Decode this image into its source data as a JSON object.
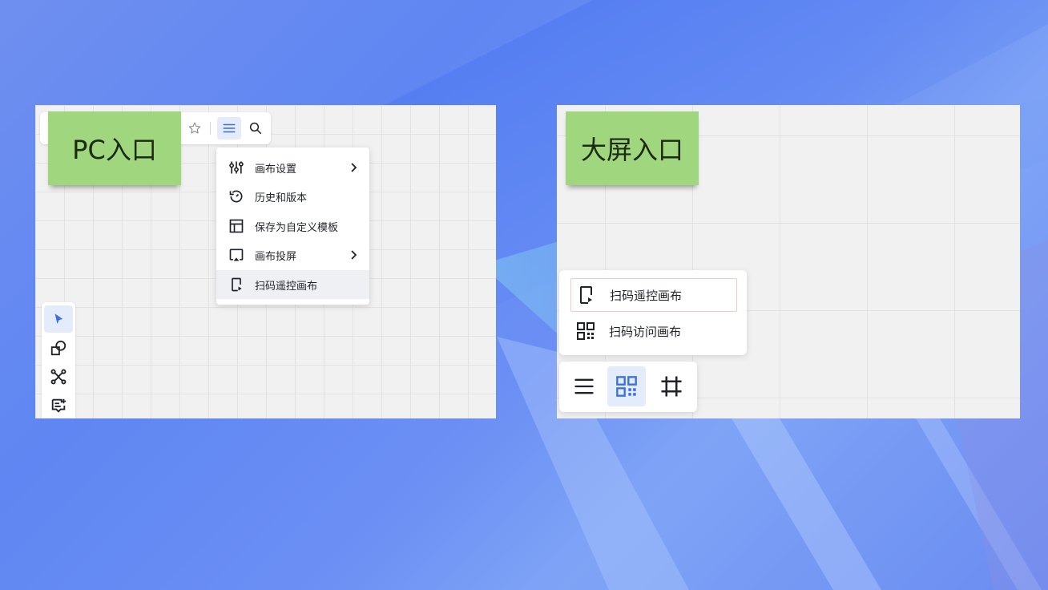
{
  "pc_panel": {
    "sticky_label": "PC入口",
    "top_toolbar": {
      "icons": [
        "star-icon",
        "menu-icon",
        "search-icon"
      ]
    },
    "menu": {
      "items": [
        {
          "label": "画布设置",
          "icon": "sliders-icon",
          "has_submenu": true
        },
        {
          "label": "历史和版本",
          "icon": "history-icon",
          "has_submenu": false
        },
        {
          "label": "保存为自定义模板",
          "icon": "template-icon",
          "has_submenu": false
        },
        {
          "label": "画布投屏",
          "icon": "cast-icon",
          "has_submenu": true
        },
        {
          "label": "扫码遥控画布",
          "icon": "phone-remote-icon",
          "has_submenu": false,
          "highlighted": true
        }
      ]
    },
    "side_tools": [
      "select-cursor-icon",
      "shape-icon",
      "connector-icon",
      "comment-icon"
    ]
  },
  "big_screen_panel": {
    "sticky_label": "大屏入口",
    "qr_popup": {
      "items": [
        {
          "label": "扫码遥控画布",
          "icon": "phone-remote-icon"
        },
        {
          "label": "扫码访问画布",
          "icon": "qr-code-icon"
        }
      ]
    },
    "bottom_bar": [
      "menu-icon",
      "qr-code-icon",
      "frame-icon"
    ]
  },
  "colors": {
    "accent": "#3a6fe0",
    "sticky": "#9fd67e",
    "canvas": "#f1f1f1"
  }
}
